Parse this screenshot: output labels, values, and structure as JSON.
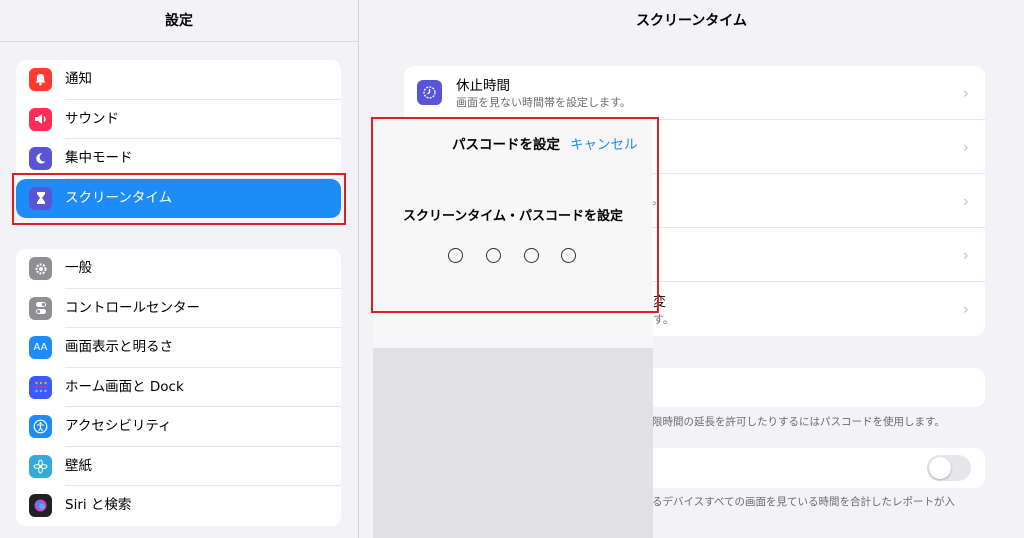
{
  "sidebar": {
    "title": "設定",
    "group1": [
      {
        "label": "通知",
        "icon": "bell-icon",
        "color": "#ff3b30"
      },
      {
        "label": "サウンド",
        "icon": "speaker-icon",
        "color": "#ff2d55"
      },
      {
        "label": "集中モード",
        "icon": "moon-icon",
        "color": "#5856d6"
      },
      {
        "label": "スクリーンタイム",
        "icon": "hourglass-icon",
        "color": "#5856d6",
        "selected": true
      }
    ],
    "group2": [
      {
        "label": "一般",
        "icon": "gear-icon",
        "color": "#8e8e93"
      },
      {
        "label": "コントロールセンター",
        "icon": "switches-icon",
        "color": "#8e8e93"
      },
      {
        "label": "画面表示と明るさ",
        "icon": "text-size-icon",
        "color": "#1e8cf7"
      },
      {
        "label": "ホーム画面と Dock",
        "icon": "grid-icon",
        "color": "#3d5afe"
      },
      {
        "label": "アクセシビリティ",
        "icon": "accessibility-icon",
        "color": "#1e8cf7"
      },
      {
        "label": "壁紙",
        "icon": "flower-icon",
        "color": "#34aadc"
      },
      {
        "label": "Siri と検索",
        "icon": "siri-icon",
        "color": "#222"
      }
    ]
  },
  "detail": {
    "title": "スクリーンタイム",
    "downtime_title": "休止時間",
    "downtime_sub": "画面を見ない時間帯を設定します。",
    "partial_text_row3": "。",
    "partial_text_row5_title": "変",
    "partial_text_row5_sub": "す。",
    "passcode_footer": "限時間の延長を許可したりするにはパスコードを使用します。",
    "share_footer": "るデバイスすべての画面を見ている時間を合計したレポートが入"
  },
  "modal": {
    "title": "パスコードを設定",
    "cancel": "キャンセル",
    "prompt": "スクリーンタイム・パスコードを設定"
  },
  "colors": {
    "accent": "#1e8cf7",
    "highlight": "#e02020"
  }
}
